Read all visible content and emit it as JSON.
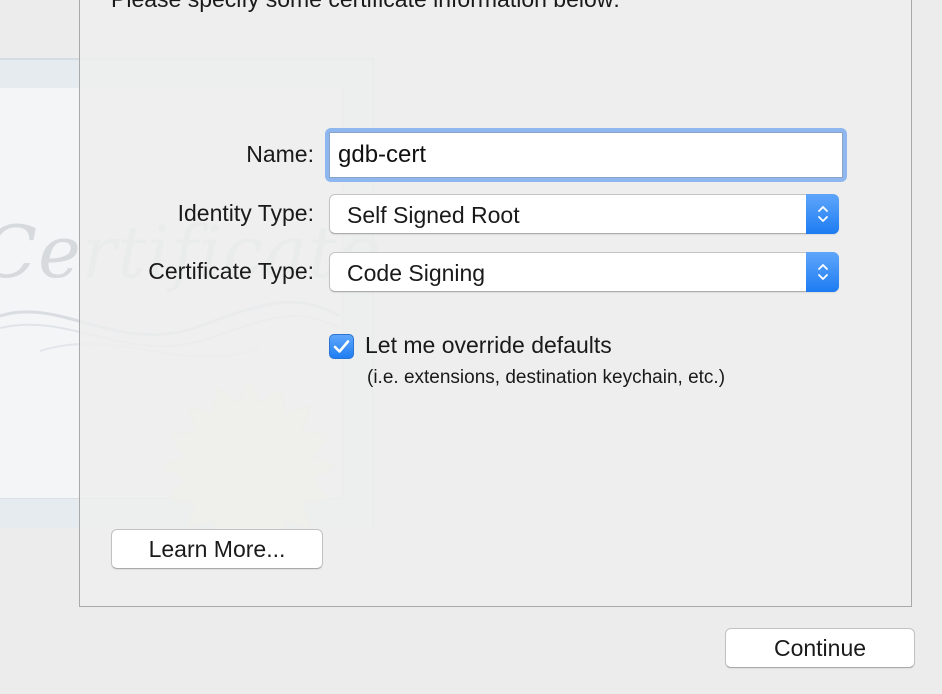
{
  "instructions": "Please specify some certificate information below:",
  "background_art": {
    "script_word": "Certificate"
  },
  "form": {
    "name": {
      "label": "Name:",
      "value": "gdb-cert"
    },
    "identity_type": {
      "label": "Identity Type:",
      "selected": "Self Signed Root"
    },
    "certificate_type": {
      "label": "Certificate Type:",
      "selected": "Code Signing"
    },
    "override": {
      "checked": true,
      "label": "Let me override defaults",
      "hint": "(i.e. extensions, destination keychain, etc.)"
    }
  },
  "buttons": {
    "learn_more": "Learn More...",
    "continue": "Continue"
  },
  "colors": {
    "accent": "#1d7cf2",
    "focus_ring": "#8db7ee",
    "window_background": "#ececec"
  },
  "icons": {
    "popup_stepper": "chevron-up-down-icon",
    "checkbox": "checkmark-icon",
    "seal": "certificate-seal-icon"
  }
}
